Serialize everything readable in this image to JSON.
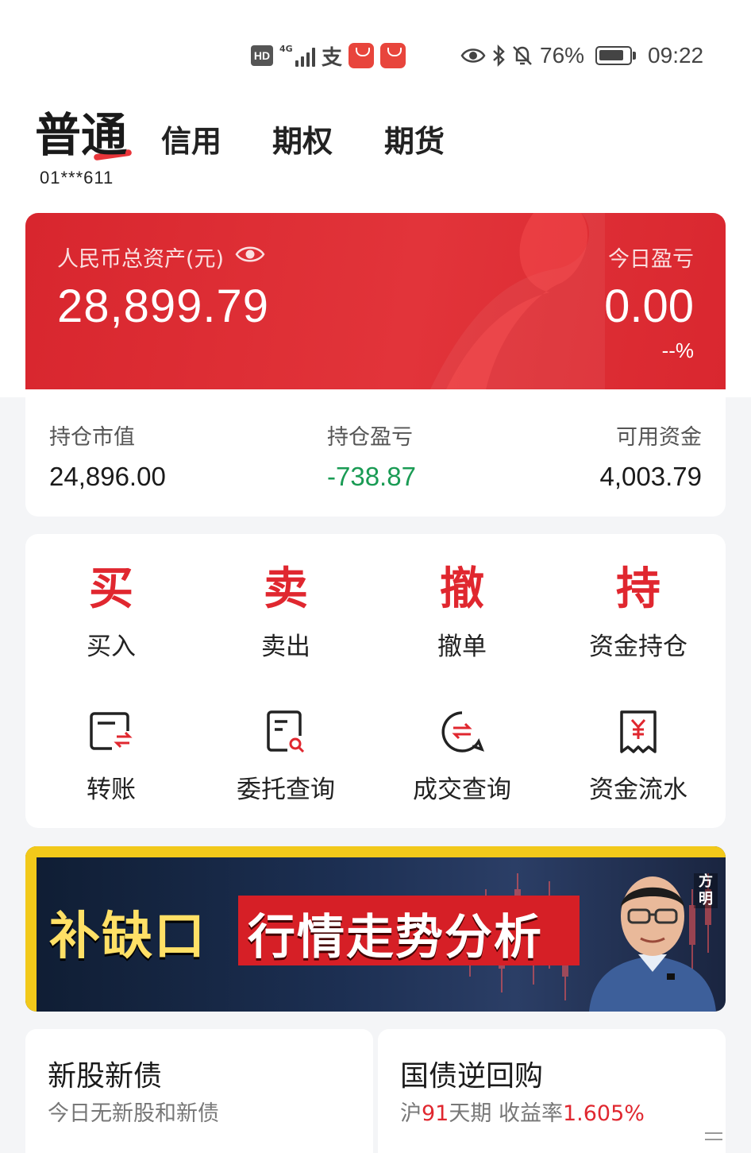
{
  "status_bar": {
    "hd": "HD",
    "network": "4G",
    "pay_icon": "支",
    "battery_pct": "76%",
    "time": "09:22"
  },
  "account_tabs": {
    "active": "普通",
    "tabs": [
      "信用",
      "期权",
      "期货"
    ],
    "account_no": "01***611"
  },
  "asset": {
    "total_label": "人民币总资产(元)",
    "total_value": "28,899.79",
    "today_label": "今日盈亏",
    "today_value": "0.00",
    "today_pct": "--%"
  },
  "stats": {
    "market_value_label": "持仓市值",
    "market_value": "24,896.00",
    "pnl_label": "持仓盈亏",
    "pnl": "-738.87",
    "cash_label": "可用资金",
    "cash": "4,003.79"
  },
  "actions": {
    "row1": [
      {
        "big": "买",
        "label": "买入"
      },
      {
        "big": "卖",
        "label": "卖出"
      },
      {
        "big": "撤",
        "label": "撤单"
      },
      {
        "big": "持",
        "label": "资金持仓"
      }
    ],
    "row2": [
      {
        "icon": "transfer-icon",
        "label": "转账"
      },
      {
        "icon": "order-query-icon",
        "label": "委托查询"
      },
      {
        "icon": "deal-query-icon",
        "label": "成交查询"
      },
      {
        "icon": "fund-flow-icon",
        "label": "资金流水"
      }
    ]
  },
  "banner": {
    "title_left": "补缺口",
    "title_right": "行情走势分析",
    "name_tag": "方明"
  },
  "tiles": {
    "ipo_title": "新股新债",
    "ipo_sub": "今日无新股和新债",
    "repo_title": "国债逆回购",
    "repo_sub_prefix": "沪",
    "repo_days": "91",
    "repo_sub_mid": "天期 收益率",
    "repo_rate": "1.605%"
  },
  "colors": {
    "brand_red": "#e0272f",
    "loss_green": "#1a9b54"
  }
}
